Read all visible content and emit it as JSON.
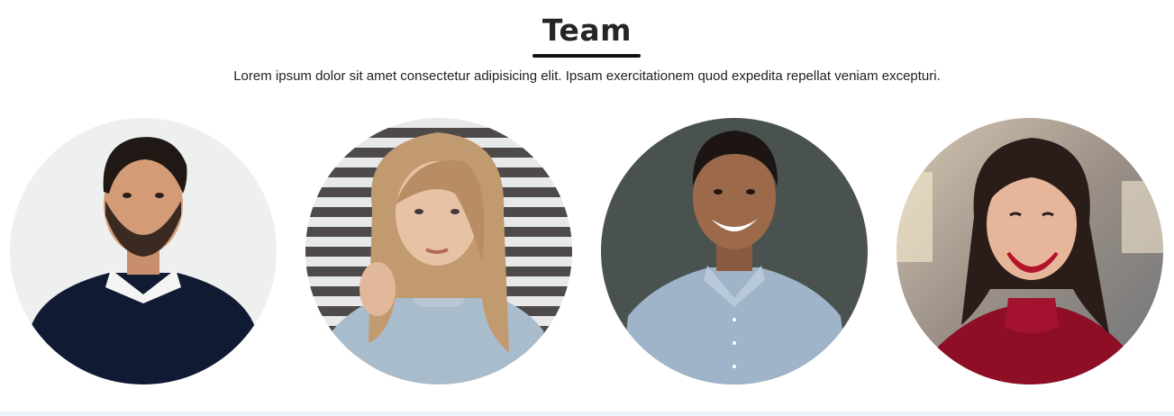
{
  "team_section": {
    "title": "Team",
    "subtitle": "Lorem ipsum dolor sit amet consectetur adipisicing elit. Ipsam exercitationem quod expedita repellat veniam excepturi.",
    "members": [
      {
        "photo": "team-member-photo-man-dark-sweater"
      },
      {
        "photo": "team-member-photo-woman-gray-turtleneck"
      },
      {
        "photo": "team-member-photo-man-checked-shirt"
      },
      {
        "photo": "team-member-photo-woman-red-top"
      }
    ]
  },
  "colors": {
    "accent": "#111111",
    "text": "#222222",
    "background": "#ffffff"
  }
}
